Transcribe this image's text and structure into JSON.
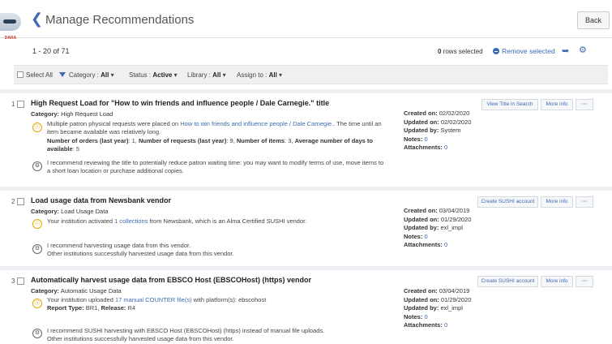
{
  "header": {
    "title": "Manage Recommendations",
    "back_label": "Back"
  },
  "avatar": {
    "label": "DARA"
  },
  "toolbar": {
    "count": "1 - 20 of 71",
    "rows_selected_count": "0",
    "rows_selected_text": " rows selected",
    "remove_selected": "Remove selected"
  },
  "filters": {
    "select_all": "Select All",
    "category_label": "Category :",
    "category_value": "All",
    "status_label": "Status :",
    "status_value": "Active",
    "library_label": "Library :",
    "library_value": "All",
    "assign_label": "Assign to :",
    "assign_value": "All"
  },
  "cards": [
    {
      "num": "1",
      "title": "High Request Load for \"How to win friends and influence people / Dale Carnegie.\" title",
      "category_label": "Category:",
      "category": "High Request Load",
      "desc1_pre": "Multiple patron physical requests were placed on ",
      "desc1_link": "How to win friends and influence people / Dale Carnegie.",
      "desc1_post": ". The time until an item became available was relatively long.",
      "stats": [
        {
          "label": "Number of orders (last year)",
          "value": "1"
        },
        {
          "label": "Number of requests (last year)",
          "value": "9"
        },
        {
          "label": "Number of items",
          "value": "3"
        },
        {
          "label": "Average number of days to available",
          "value": "5"
        }
      ],
      "rec": "I recommend reviewing the title to potentially reduce patron waiting time: you may want to modify terms of use, move items to a short loan location or purchase additional copies.",
      "created": "02/02/2020",
      "updated": "02/02/2020",
      "updated_by": "System",
      "notes": "0",
      "attachments": "0",
      "action": "View Title in Search",
      "more": "More info",
      "dots": "···"
    },
    {
      "num": "2",
      "title": "Load usage data from Newsbank vendor",
      "category_label": "Category:",
      "category": "Load Usage Data",
      "desc1_pre": "Your institution activated ",
      "desc1_link": "1 collections",
      "desc1_post": " from Newsbank, which is an Alma Certified SUSHI vendor.",
      "rec1": "I recommend harvesting usage data from this vendor.",
      "rec2": "Other institutions successfully harvested usage data from this vendor.",
      "created": "03/04/2019",
      "updated": "01/29/2020",
      "updated_by": "exl_impl",
      "notes": "0",
      "attachments": "0",
      "action": "Create SUSHI account",
      "more": "More info",
      "dots": "···"
    },
    {
      "num": "3",
      "title": "Automatically harvest usage data from EBSCO Host (EBSCOHost) (https) vendor",
      "category_label": "Category:",
      "category": "Automatic Usage Data",
      "desc1_pre": "Your institution uploaded ",
      "desc1_link": "17 manual COUNTER file(s)",
      "desc1_post": " with platform(s): ebscohost",
      "report_label": "Report Type:",
      "report_value": "BR1",
      "release_label": "Release:",
      "release_value": "R4",
      "rec1": "I recommend SUSHI harvesting with EBSCO Host (EBSCOHost) (https) instead of manual file uploads.",
      "rec2": "Other institutions successfully harvested usage data from this vendor.",
      "created": "03/04/2019",
      "updated": "01/29/2020",
      "updated_by": "exl_impl",
      "notes": "0",
      "attachments": "0",
      "action": "Create SUSHI account",
      "more": "More info",
      "dots": "···"
    }
  ],
  "meta_labels": {
    "created": "Created on:",
    "updated": "Updated on:",
    "updated_by": "Updated by:",
    "notes": "Notes:",
    "attachments": "Attachments:"
  },
  "colors": {
    "accent": "#3d6bb3",
    "bulb": "#e0a800"
  }
}
